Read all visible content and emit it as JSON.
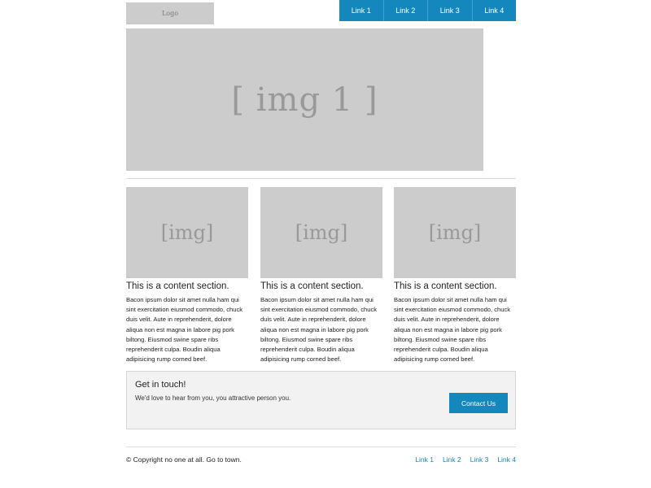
{
  "header": {
    "logo_text": "Logo",
    "nav": [
      {
        "label": "Link 1"
      },
      {
        "label": "Link 2"
      },
      {
        "label": "Link 3"
      },
      {
        "label": "Link 4"
      }
    ]
  },
  "hero": {
    "placeholder": "[ img 1 ]"
  },
  "columns": [
    {
      "image_placeholder": "[img]",
      "title": "This is a content section.",
      "body": "Bacon ipsum dolor sit amet nulla ham qui sint exercitation eiusmod commodo, chuck duis velit. Aute in reprehenderit, dolore aliqua non est magna in labore pig pork biltong. Eiusmod swine spare ribs reprehenderit culpa. Boudin aliqua adipisicing rump corned beef."
    },
    {
      "image_placeholder": "[img]",
      "title": "This is a content section.",
      "body": "Bacon ipsum dolor sit amet nulla ham qui sint exercitation eiusmod commodo, chuck duis velit. Aute in reprehenderit, dolore aliqua non est magna in labore pig pork biltong. Eiusmod swine spare ribs reprehenderit culpa. Boudin aliqua adipisicing rump corned beef."
    },
    {
      "image_placeholder": "[img]",
      "title": "This is a content section.",
      "body": "Bacon ipsum dolor sit amet nulla ham qui sint exercitation eiusmod commodo, chuck duis velit. Aute in reprehenderit, dolore aliqua non est magna in labore pig pork biltong. Eiusmod swine spare ribs reprehenderit culpa. Boudin aliqua adipisicing rump corned beef."
    }
  ],
  "contact": {
    "title": "Get in touch!",
    "text": "We'd love to hear from you, you attractive person you.",
    "button_label": "Contact Us"
  },
  "footer": {
    "copyright": "© Copyright no one at all. Go to town.",
    "links": [
      {
        "label": "Link 1"
      },
      {
        "label": "Link 2"
      },
      {
        "label": "Link 3"
      },
      {
        "label": "Link 4"
      }
    ]
  },
  "colors": {
    "accent": "#1488bd",
    "placeholder_bg": "#cccccc",
    "placeholder_text": "#999999",
    "panel_bg": "#f2f2f2"
  }
}
